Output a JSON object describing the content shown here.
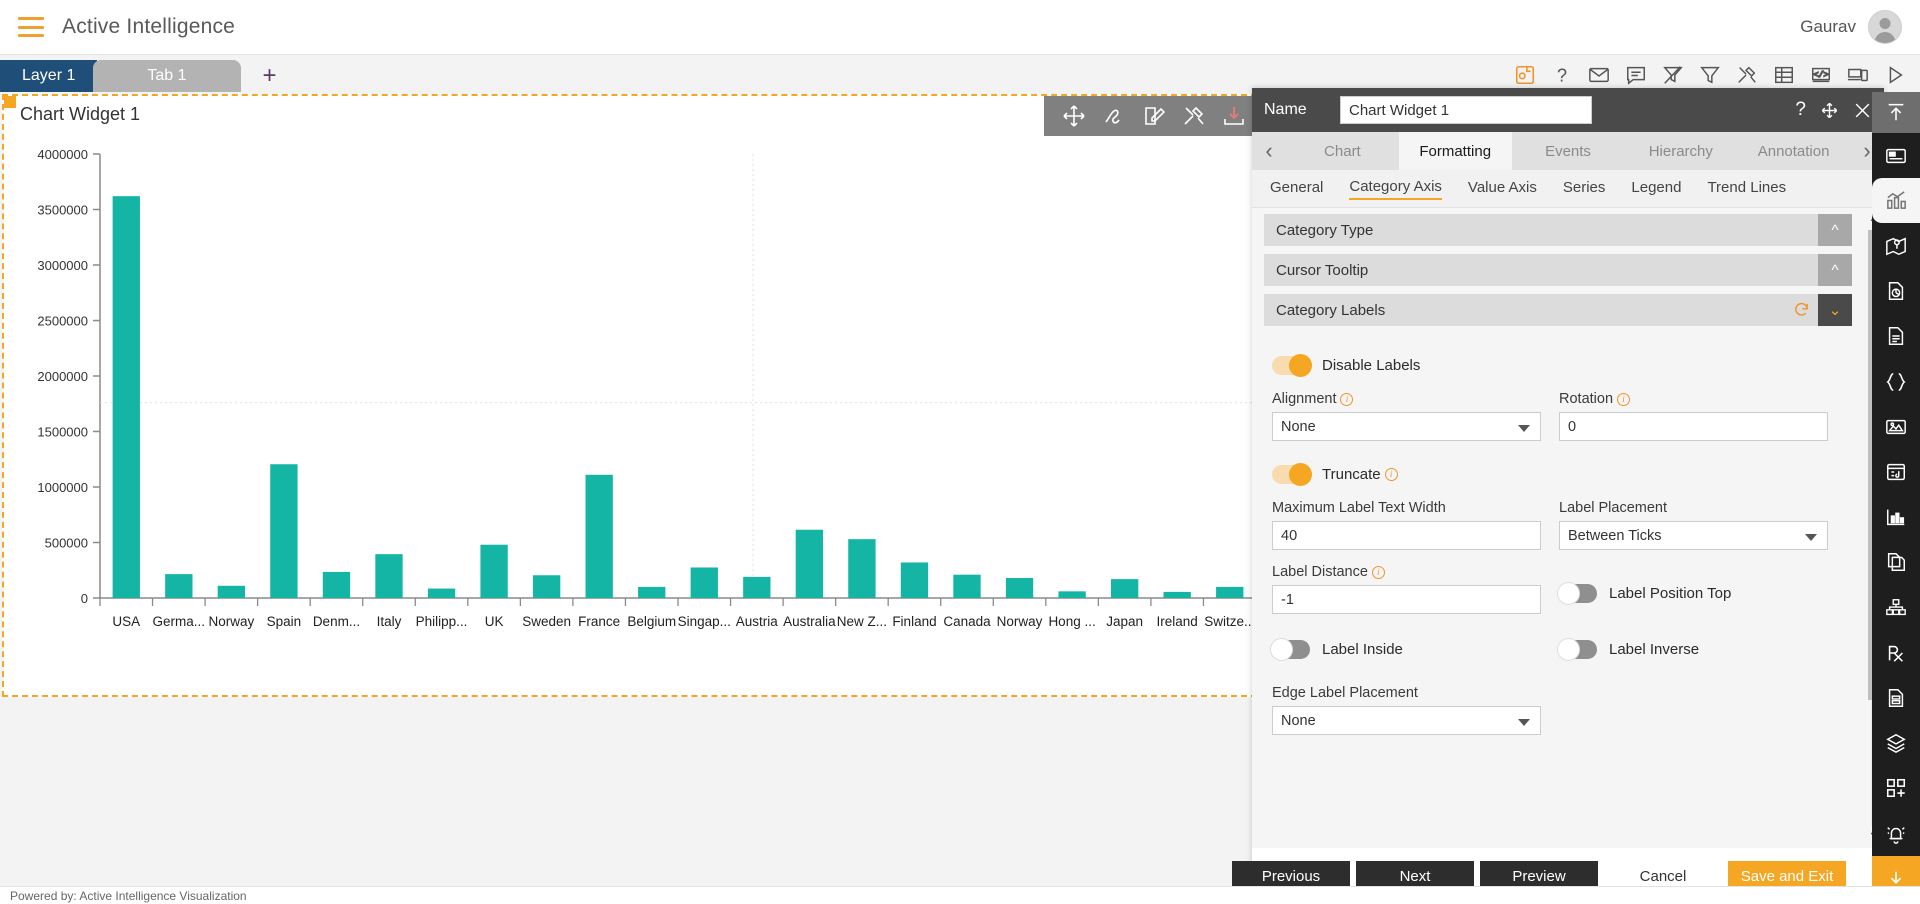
{
  "appbar": {
    "menu_icon": "hamburger-icon",
    "title": "Active Intelligence",
    "user_name": "Gaurav",
    "avatar_icon": "user-avatar-icon"
  },
  "tabstrip": {
    "layer_label": "Layer 1",
    "tab_label": "Tab 1",
    "add_label": "+",
    "icons": [
      "save-icon",
      "help-icon",
      "mail-icon",
      "comment-icon",
      "clear-filter-icon",
      "filter-icon",
      "tools-icon",
      "table-icon",
      "code-icon",
      "devices-icon",
      "play-icon"
    ]
  },
  "widget": {
    "title": "Chart Widget 1",
    "toolbar_icons": [
      "move-icon",
      "scribble-icon",
      "edit-icon",
      "tools-icon",
      "download-icon",
      "more-options-icon"
    ]
  },
  "chart_data": {
    "type": "bar",
    "title": "Chart Widget 1",
    "xlabel": "",
    "ylabel": "",
    "ylim": [
      0,
      4000000
    ],
    "yticks": [
      0,
      500000,
      1000000,
      1500000,
      2000000,
      2500000,
      3000000,
      3500000,
      4000000
    ],
    "ytick_labels": [
      "0",
      "500000",
      "1000000",
      "1500000",
      "2000000",
      "2500000",
      "3000000",
      "3500000",
      "4000000"
    ],
    "grid": false,
    "legend": "none",
    "bar_color": "#14b5a5",
    "categories": [
      "USA",
      "Germa...",
      "Norway",
      "Spain",
      "Denm...",
      "Italy",
      "Philipp...",
      "UK",
      "Sweden",
      "France",
      "Belgium",
      "Singap...",
      "Austria",
      "Australia",
      "New Z...",
      "Finland",
      "Canada",
      "Norway",
      "Hong ...",
      "Japan",
      "Ireland",
      "Switze..."
    ],
    "values": [
      3620000,
      215000,
      110000,
      1205000,
      235000,
      395000,
      85000,
      480000,
      205000,
      1110000,
      100000,
      275000,
      190000,
      615000,
      530000,
      320000,
      210000,
      180000,
      60000,
      170000,
      55000,
      100000
    ]
  },
  "panel": {
    "name_label": "Name",
    "name_value": "Chart Widget 1",
    "help_icon": "help-icon",
    "move_icon": "move-icon",
    "close_icon": "close-icon",
    "prev_arrow": "chevron-left-icon",
    "next_arrow": "chevron-right-icon",
    "tabs": [
      {
        "label": "Chart",
        "active": false
      },
      {
        "label": "Formatting",
        "active": true
      },
      {
        "label": "Events",
        "active": false
      },
      {
        "label": "Hierarchy",
        "active": false
      },
      {
        "label": "Annotation",
        "active": false
      }
    ],
    "subtabs": [
      {
        "label": "General",
        "active": false
      },
      {
        "label": "Category Axis",
        "active": true
      },
      {
        "label": "Value Axis",
        "active": false
      },
      {
        "label": "Series",
        "active": false
      },
      {
        "label": "Legend",
        "active": false
      },
      {
        "label": "Trend Lines",
        "active": false
      }
    ],
    "sections": {
      "category_type": "Category Type",
      "cursor_tooltip": "Cursor Tooltip",
      "category_labels": "Category Labels"
    },
    "fields": {
      "disable_labels_label": "Disable Labels",
      "disable_labels_state": "on",
      "alignment_label": "Alignment",
      "alignment_value": "None",
      "rotation_label": "Rotation",
      "rotation_value": "0",
      "truncate_label": "Truncate",
      "truncate_state": "on",
      "max_label_text_width_label": "Maximum Label Text Width",
      "max_label_text_width_value": "40",
      "label_placement_label": "Label Placement",
      "label_placement_value": "Between Ticks",
      "label_distance_label": "Label Distance",
      "label_distance_value": "-1",
      "label_position_top_label": "Label Position Top",
      "label_position_top_state": "off",
      "label_inside_label": "Label Inside",
      "label_inside_state": "off",
      "label_inverse_label": "Label Inverse",
      "label_inverse_state": "off",
      "edge_label_placement_label": "Edge Label Placement",
      "edge_label_placement_value": "None"
    },
    "buttons": {
      "previous": "Previous",
      "next": "Next",
      "preview": "Preview",
      "cancel": "Cancel",
      "save_exit": "Save and Exit"
    }
  },
  "rail": {
    "top_icon": "collapse-up-icon",
    "items": [
      "widget-icon",
      "chart-icon",
      "map-icon",
      "pie-report-icon",
      "document-icon",
      "json-icon",
      "image-icon",
      "media-icon",
      "sparkline-icon",
      "copy-page-icon",
      "hierarchy-icon",
      "prescription-icon",
      "form-icon",
      "layers-icon",
      "add-widget-icon",
      "alerts-icon"
    ],
    "bottom_icon": "download-icon"
  },
  "footer": {
    "text": "Powered by: Active Intelligence Visualization"
  },
  "colors": {
    "brand_orange": "#f5a623",
    "layer_blue": "#1f4e79",
    "bar_teal": "#14b5a5",
    "panel_dark": "#4a4a4a"
  }
}
